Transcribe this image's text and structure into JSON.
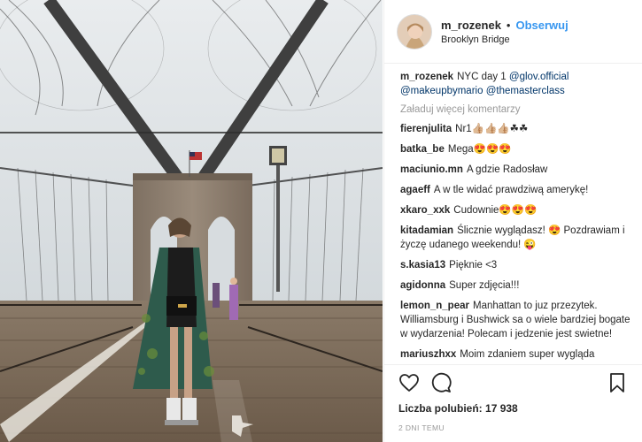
{
  "post": {
    "username": "m_rozenek",
    "dot": "•",
    "follow_label": "Obserwuj",
    "location": "Brooklyn Bridge",
    "caption": {
      "user": "m_rozenek",
      "text": "NYC day 1",
      "mentions": [
        "@glov.official",
        "@makeupbymario",
        "@themasterclass"
      ]
    },
    "load_more": "Załaduj więcej komentarzy",
    "comments": [
      {
        "user": "fierenjulita",
        "text": "Nr1👍🏼👍🏼👍🏼☘☘"
      },
      {
        "user": "batka_be",
        "text": "Mega😍😍😍"
      },
      {
        "user": "maciunio.mn",
        "text": "A gdzie Radosław"
      },
      {
        "user": "agaeff",
        "text": "A w tle widać prawdziwą amerykę!"
      },
      {
        "user": "xkaro_xxk",
        "text": "Cudownie😍😍😍"
      },
      {
        "user": "kitadamian",
        "text": "Ślicznie wyglądasz! 😍 Pozdrawiam i życzę udanego weekendu! 😜"
      },
      {
        "user": "s.kasia13",
        "text": "Pięknie <3"
      },
      {
        "user": "agidonna",
        "text": "Super zdjęcia!!!"
      },
      {
        "user": "lemon_n_pear",
        "text": "Manhattan to juz przezytek. Williamsburg i Bushwick sa o wiele bardziej bogate w wydarzenia! Polecam i jedzenie jest swietne!"
      },
      {
        "user": "mariuszhxx",
        "text": "Moim zdaniem super wygląda"
      }
    ],
    "likes_label": "Liczba polubień:",
    "likes_count": "17 938",
    "timestamp": "2 DNI TEMU",
    "icons": [
      "heart-icon",
      "comment-icon",
      "bookmark-icon"
    ],
    "colors": {
      "link": "#003569",
      "follow": "#3897f0",
      "muted": "#999999"
    }
  }
}
